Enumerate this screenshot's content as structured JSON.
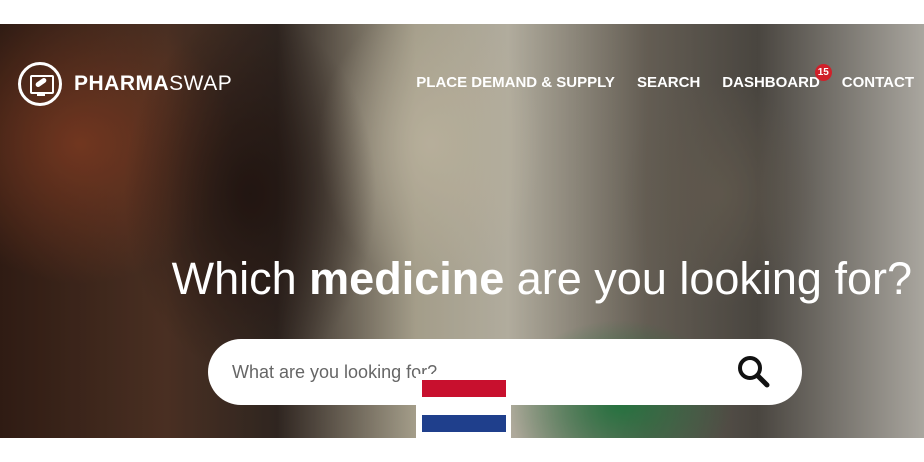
{
  "brand": {
    "bold": "PHARMA",
    "light": "SWAP"
  },
  "nav": {
    "place": "PLACE DEMAND & SUPPLY",
    "search": "SEARCH",
    "dashboard": "DASHBOARD",
    "dashboard_badge": "15",
    "contact": "CONTACT"
  },
  "hero": {
    "pre": "Which ",
    "bold": "medicine",
    "post": " are you looking for?"
  },
  "search": {
    "placeholder": "What are you looking for?"
  },
  "icons": {
    "logo": "monitor-pill-icon",
    "search": "magnifier-icon",
    "flag": "netherlands-flag-icon"
  },
  "colors": {
    "badge": "#d0202a",
    "flag_red": "#c8102e",
    "flag_blue": "#1f3f8c"
  }
}
